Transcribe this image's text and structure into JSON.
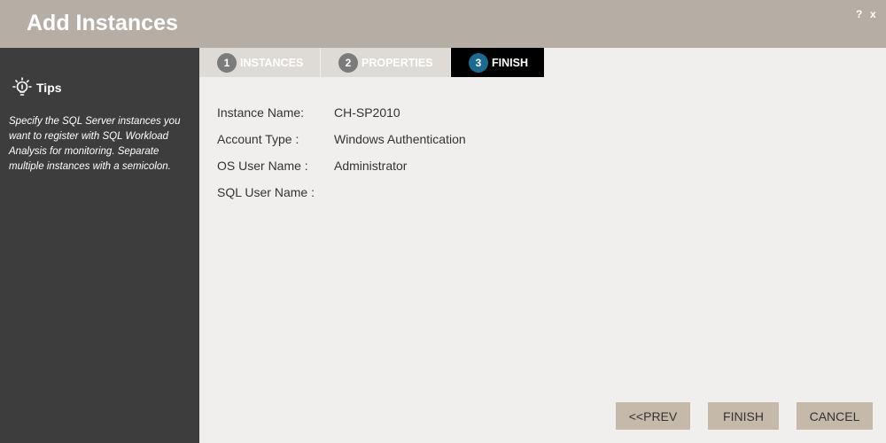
{
  "dialog": {
    "title": "Add Instances",
    "help_label": "?",
    "close_label": "x"
  },
  "sidebar": {
    "tips_title": "Tips",
    "tips_text": "Specify the SQL Server instances you want to register with SQL Workload Analysis for monitoring. Separate multiple instances with a semicolon."
  },
  "tabs": [
    {
      "number": "1",
      "label": "INSTANCES"
    },
    {
      "number": "2",
      "label": "PROPERTIES"
    },
    {
      "number": "3",
      "label": "FINISH"
    }
  ],
  "summary": [
    {
      "label": "Instance Name:",
      "value": "CH-SP2010"
    },
    {
      "label": "Account Type :",
      "value": "Windows Authentication"
    },
    {
      "label": "OS User Name :",
      "value": "Administrator"
    },
    {
      "label": "SQL User Name :",
      "value": ""
    }
  ],
  "buttons": {
    "prev": "<<PREV",
    "finish": "FINISH",
    "cancel": "CANCEL"
  },
  "colors": {
    "header": "#b6ada5",
    "sidebar": "#3d3d3d",
    "active_tab": "#000000",
    "active_step": "#1a6b91",
    "button": "#c5b9aa"
  }
}
